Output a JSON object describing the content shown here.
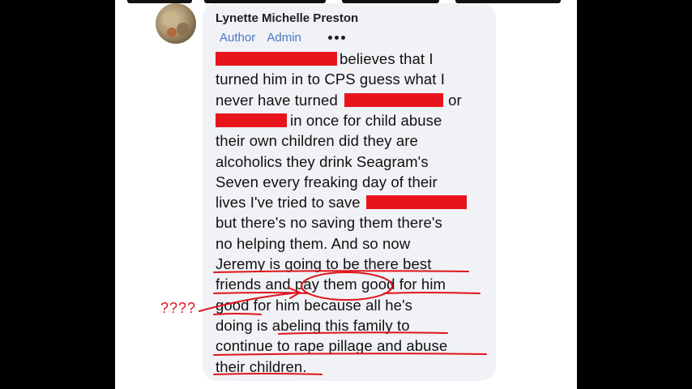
{
  "post": {
    "author": "Lynette Michelle Preston",
    "badges": [
      "Author",
      "Admin"
    ],
    "more_icon": "ellipsis-icon",
    "lines": [
      "believes that I",
      "turned him in to CPS guess what I",
      "never have turned",
      "or",
      "in once for child abuse",
      "their own children did they are",
      "alcoholics they drink Seagram's",
      "Seven every freaking day of their",
      "lives I've tried to save",
      "but there's no saving them there's",
      "no helping them. And so now",
      "Jeremy is going to be there best",
      "friends and pay them good for him",
      "good for him because all he's",
      "doing is abeling this family to",
      "continue to rape pillage and abuse",
      "their children."
    ]
  },
  "annotation": {
    "question_marks": "????",
    "color": "#e0141c"
  },
  "colors": {
    "bubble": "#f0f2f5",
    "badge_text": "#4a76c9",
    "redaction": "#e8141c",
    "background": "#000000"
  }
}
